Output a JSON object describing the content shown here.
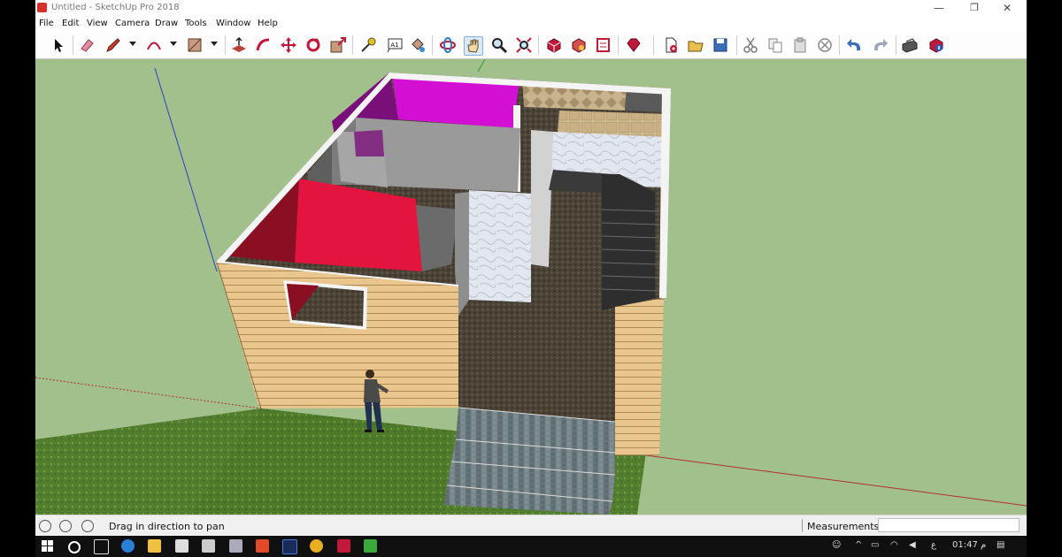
{
  "window": {
    "title": "Untitled - SketchUp Pro 2018",
    "minimize_glyph": "—",
    "restore_glyph": "❐",
    "close_glyph": "✕"
  },
  "menu": [
    "File",
    "Edit",
    "View",
    "Camera",
    "Draw",
    "Tools",
    "Window",
    "Help"
  ],
  "toolbar": {
    "tools": [
      {
        "name": "select-icon"
      },
      {
        "name": "eraser-icon"
      },
      {
        "name": "line-pencil-icon"
      },
      {
        "name": "arc-icon"
      },
      {
        "name": "rectangle-icon"
      },
      {
        "name": "push-pull-icon"
      },
      {
        "name": "follow-me-icon"
      },
      {
        "name": "move-icon"
      },
      {
        "name": "rotate-icon"
      },
      {
        "name": "scale-icon"
      },
      {
        "name": "tape-measure-icon"
      },
      {
        "name": "text-icon"
      },
      {
        "name": "paint-bucket-icon"
      },
      {
        "name": "orbit-icon"
      },
      {
        "name": "pan-hand-icon"
      },
      {
        "name": "zoom-icon"
      },
      {
        "name": "zoom-extents-icon"
      },
      {
        "name": "3d-warehouse-icon"
      },
      {
        "name": "extension-warehouse-icon"
      },
      {
        "name": "layout-icon"
      },
      {
        "name": "ruby-icon"
      },
      {
        "name": "new-file-icon"
      },
      {
        "name": "open-folder-icon"
      },
      {
        "name": "save-icon"
      },
      {
        "name": "cut-icon"
      },
      {
        "name": "copy-icon"
      },
      {
        "name": "paste-icon"
      },
      {
        "name": "delete-icon"
      },
      {
        "name": "undo-icon"
      },
      {
        "name": "redo-icon"
      },
      {
        "name": "print-icon"
      },
      {
        "name": "model-info-icon"
      }
    ]
  },
  "text_tool_label": "A1",
  "status": {
    "message": "Drag in direction to pan",
    "measurements_label": "Measurements",
    "measurements_value": ""
  },
  "taskbar": {
    "clock": "01:47 م",
    "lang": "ع"
  },
  "colors": {
    "sky_ground": "#a2c08b",
    "grass": "#4f7a2a",
    "magenta_wall": "#d40fd4",
    "red_wall": "#e3143e",
    "wood_siding": "#e8c68e"
  }
}
